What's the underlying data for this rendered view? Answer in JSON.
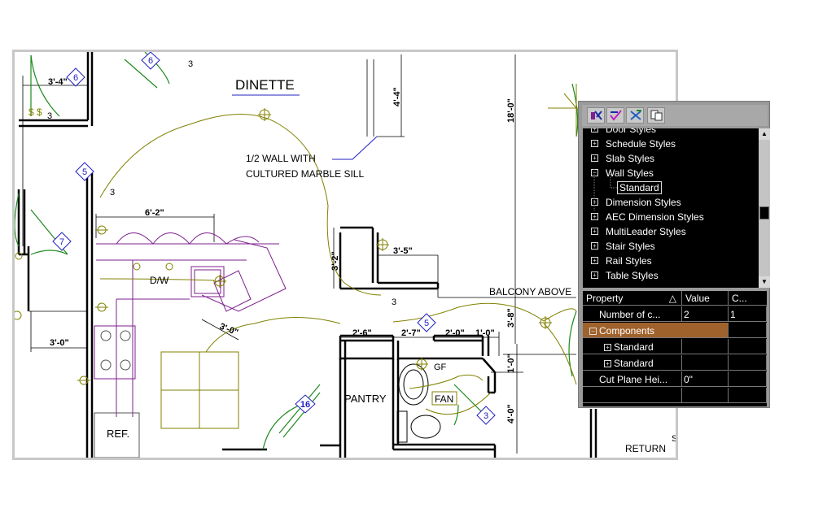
{
  "drawing": {
    "room_dinette": "DINETTE",
    "note_line1": "1/2 WALL WITH",
    "note_line2": "CULTURED MARBLE SILL",
    "dim_3_4": "3'-4\"",
    "dim_4_4": "4'-4\"",
    "dim_18_0": "18'-0\"",
    "dim_6_2": "6'-2\"",
    "dim_3_2": "3'-2\"",
    "dim_3_5": "3'-5\"",
    "dim_3_0_left": "3'-0\"",
    "dim_3_0_dw": "3'-0\"",
    "dim_2_6": "2'-6\"",
    "dim_2_7": "2'-7\"",
    "dim_2_0": "2'-0\"",
    "dim_1_0": "1'-0\"",
    "dim_3_8": "3'-8\"",
    "dim_1_0v": "1'-0\"",
    "dim_4_0": "4'-0\"",
    "label_dw": "D/W",
    "label_ref": "REF.",
    "label_pantry": "PANTRY",
    "label_gf": "GF",
    "label_fan": "FAN",
    "label_balcony": "BALCONY ABOVE",
    "label_return": "RETURN",
    "label_s": "S",
    "tag_6a": "6",
    "tag_6b": "6",
    "tag_5": "5",
    "tag_7": "7",
    "tag_5b": "5",
    "tag_3": "3",
    "tag_16": "16",
    "circuit_3a": "3",
    "circuit_3b": "3",
    "circuit_3c": "3",
    "circuit_3d": "3",
    "switch_sss": "$ $"
  },
  "palette": {
    "tree_items": [
      {
        "label": "Door Styles",
        "expander": "+"
      },
      {
        "label": "Schedule Styles",
        "expander": "+"
      },
      {
        "label": "Slab Styles",
        "expander": "+"
      },
      {
        "label": "Wall Styles",
        "expander": "−"
      },
      {
        "label": "Dimension Styles",
        "expander": "+"
      },
      {
        "label": "AEC Dimension Styles",
        "expander": "+"
      },
      {
        "label": "MultiLeader Styles",
        "expander": "+"
      },
      {
        "label": "Stair Styles",
        "expander": "+"
      },
      {
        "label": "Rail Styles",
        "expander": "+"
      },
      {
        "label": "Table Styles",
        "expander": "+"
      }
    ],
    "tree_selected_child": "Standard",
    "props_header": {
      "property": "Property",
      "value": "Value",
      "c": "C...",
      "sort_icon": "△"
    },
    "rows": {
      "number": {
        "name": "Number of c...",
        "value": "2",
        "c": "1"
      },
      "components": {
        "name": "Components",
        "expander": "−"
      },
      "std1": {
        "name": "Standard",
        "expander": "+"
      },
      "std2": {
        "name": "Standard",
        "expander": "+"
      },
      "cut": {
        "name": "Cut Plane Hei...",
        "value": "0\""
      }
    }
  },
  "colors": {
    "wall": "#000000",
    "electrical": "#808000",
    "casework": "#7d1f8e",
    "door": "#1c8a1c",
    "tag": "#2020c0",
    "highlight": "#a0622c"
  }
}
